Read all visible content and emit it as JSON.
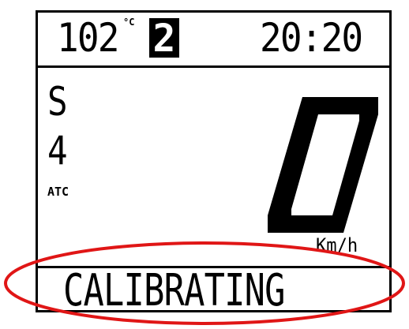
{
  "display": {
    "temperature": "102",
    "temperature_unit": "°C",
    "gear": "2",
    "time": "20:20",
    "mode": "S",
    "mode_level": "4",
    "traction_control": "ATC",
    "speed": "0",
    "speed_unit": "Km/h",
    "status_message": "CALIBRATING"
  },
  "colors": {
    "lcd_foreground": "#000000",
    "lcd_background": "#ffffff",
    "highlight": "#e01616"
  }
}
